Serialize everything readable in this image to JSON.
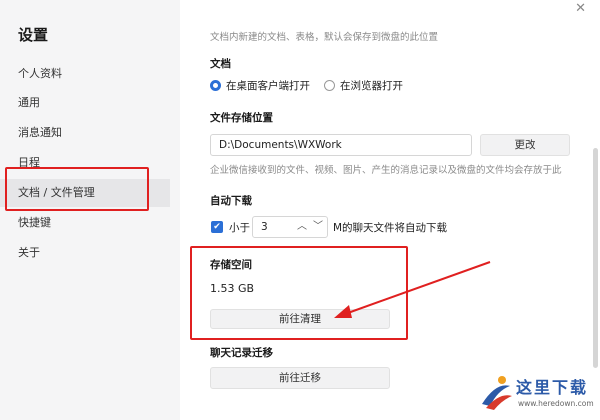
{
  "sidebar": {
    "title": "设置",
    "items": [
      {
        "label": "个人资料"
      },
      {
        "label": "通用"
      },
      {
        "label": "消息通知"
      },
      {
        "label": "日程"
      },
      {
        "label": "文档 / 文件管理",
        "active": true
      },
      {
        "label": "快捷键"
      },
      {
        "label": "关于"
      }
    ]
  },
  "main": {
    "top_hint": "文档内新建的文档、表格，默认会保存到微盘的此位置",
    "doc_section": {
      "title": "文档",
      "options": [
        {
          "label": "在桌面客户端打开",
          "checked": true
        },
        {
          "label": "在浏览器打开",
          "checked": false
        }
      ]
    },
    "storage_location": {
      "title": "文件存储位置",
      "path": "D:\\Documents\\WXWork",
      "change_button": "更改",
      "hint": "企业微信接收到的文件、视频、图片、产生的消息记录以及微盘的文件均会存放于此"
    },
    "auto_download": {
      "title": "自动下载",
      "checked": true,
      "prefix": "小于",
      "value": "3",
      "suffix": "M的聊天文件将自动下载"
    },
    "storage_space": {
      "title": "存储空间",
      "size": "1.53 GB",
      "clean_button": "前往清理"
    },
    "chat_migration": {
      "title": "聊天记录迁移",
      "migrate_button": "前往迁移"
    }
  },
  "icons": {
    "close": "close-icon",
    "check": "check-icon",
    "chevron_up": "chevron-up-icon",
    "chevron_down": "chevron-down-icon"
  },
  "colors": {
    "accent": "#2b6fd6",
    "annotation": "#e02020",
    "sidebar_bg": "#f5f5f6",
    "active_bg": "#e6e6e8"
  },
  "watermark": {
    "text": "这里下载",
    "url": "www.heredown.com"
  }
}
